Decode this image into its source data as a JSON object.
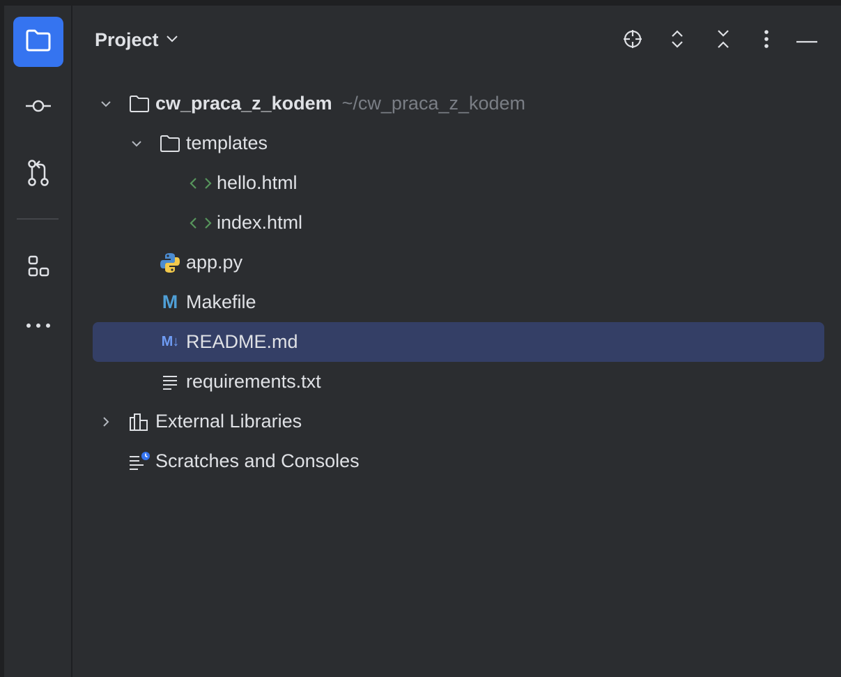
{
  "panel": {
    "title": "Project"
  },
  "toolstrip": {
    "items": [
      {
        "name": "project-tool-button",
        "icon": "folder-icon",
        "active": true
      },
      {
        "name": "commit-tool-button",
        "icon": "commit-icon",
        "active": false
      },
      {
        "name": "pull-requests-tool-button",
        "icon": "pull-request-icon",
        "active": false
      },
      {
        "name": "structure-tool-button",
        "icon": "structure-icon",
        "active": false
      },
      {
        "name": "more-tools-button",
        "icon": "more-horizontal-icon",
        "active": false
      }
    ]
  },
  "header_actions": [
    {
      "name": "select-opened-file-button",
      "icon": "crosshair-icon"
    },
    {
      "name": "expand-all-button",
      "icon": "expand-all-icon"
    },
    {
      "name": "collapse-all-button",
      "icon": "collapse-all-icon"
    },
    {
      "name": "options-button",
      "icon": "more-vertical-icon"
    },
    {
      "name": "hide-panel-button",
      "icon": "minimize-icon"
    }
  ],
  "tree": {
    "root": {
      "label": "cw_praca_z_kodem",
      "path": "~/cw_praca_z_kodem"
    },
    "templates": {
      "label": "templates"
    },
    "hello": {
      "label": "hello.html"
    },
    "index": {
      "label": "index.html"
    },
    "app": {
      "label": "app.py"
    },
    "makefile": {
      "label": "Makefile",
      "icon_text": "M"
    },
    "readme": {
      "label": "README.md",
      "icon_text": "M↓"
    },
    "requirements": {
      "label": "requirements.txt"
    },
    "external": {
      "label": "External Libraries"
    },
    "scratches": {
      "label": "Scratches and Consoles"
    }
  },
  "colors": {
    "background": "#2b2d30",
    "accent": "#3574f0",
    "selection": "#343f66",
    "text": "#dfe1e5",
    "muted_text": "#7a7e85",
    "html_icon": "#57965c"
  }
}
